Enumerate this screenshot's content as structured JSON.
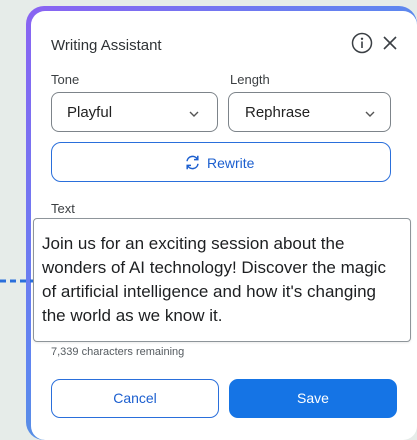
{
  "dialog": {
    "title": "Writing Assistant",
    "info_icon": "info-icon",
    "close_icon": "close-icon"
  },
  "tone": {
    "label": "Tone",
    "value": "Playful"
  },
  "length": {
    "label": "Length",
    "value": "Rephrase"
  },
  "rewrite": {
    "label": "Rewrite",
    "icon": "refresh-icon"
  },
  "text": {
    "label": "Text",
    "content": "Join us for an exciting session about the wonders of AI technology! Discover the magic of artificial intelligence and how it's changing the world as we know it.",
    "remaining": "7,339 characters remaining"
  },
  "actions": {
    "cancel": "Cancel",
    "save": "Save"
  },
  "colors": {
    "accent": "#1574e5",
    "gradient_start": "#8a63f2",
    "gradient_end": "#27bfa6",
    "connector": "#2a6fdb"
  }
}
